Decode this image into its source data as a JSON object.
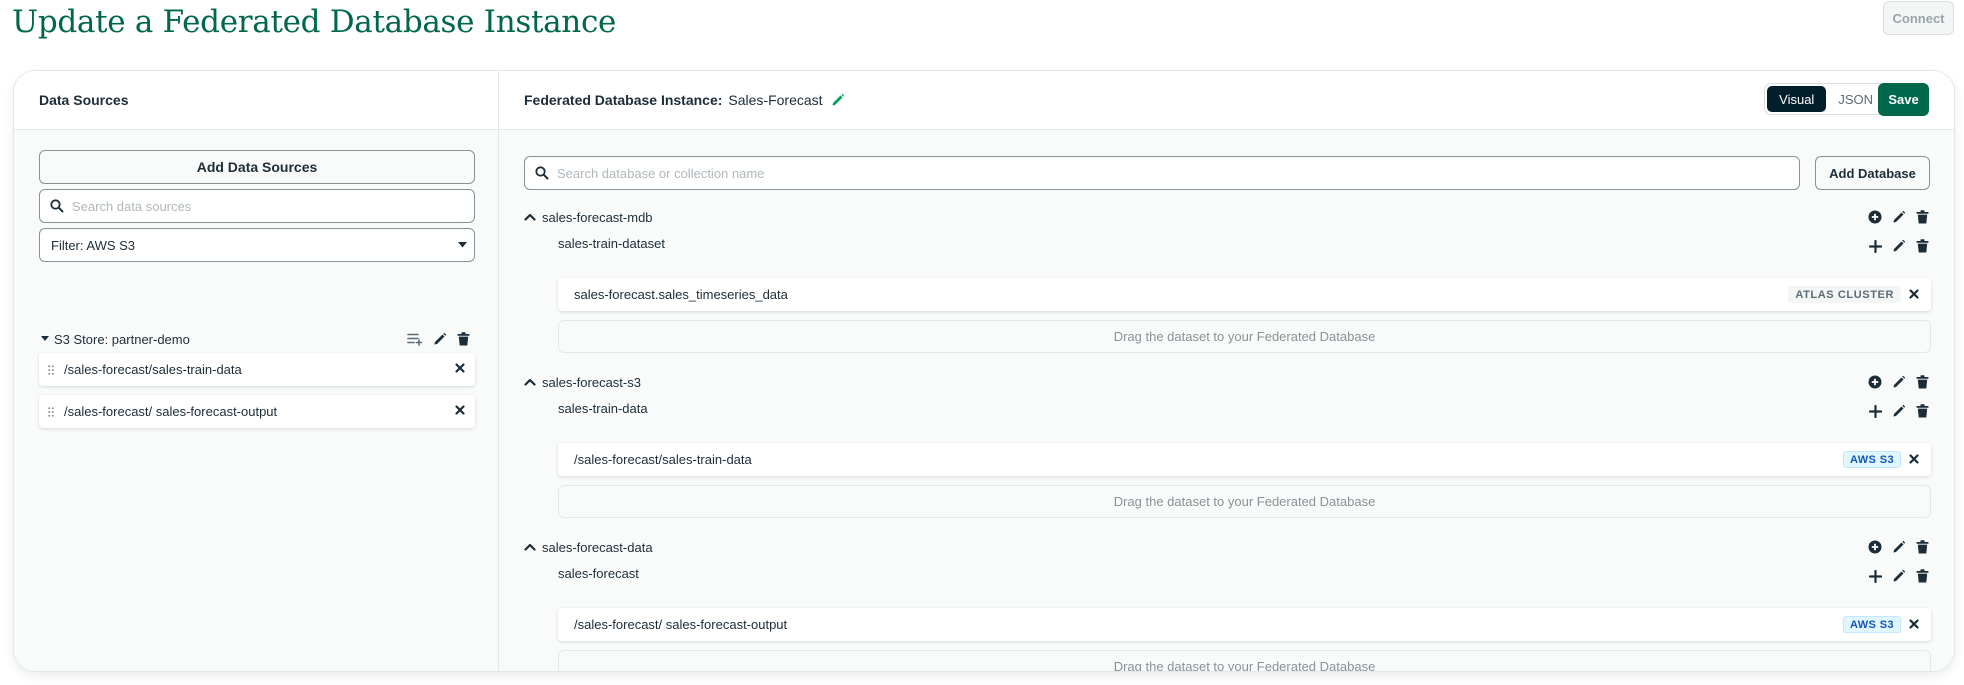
{
  "page": {
    "title": "Update a Federated Database Instance",
    "connect_label": "Connect"
  },
  "left": {
    "title": "Data Sources",
    "add_label": "Add Data Sources",
    "search_placeholder": "Search data sources",
    "filter_label": "Filter: AWS S3",
    "store": {
      "name": "S3 Store: partner-demo",
      "items": [
        "/sales-forecast/sales-train-data",
        "/sales-forecast/ sales-forecast-output"
      ]
    }
  },
  "right": {
    "instance_label": "Federated Database Instance:",
    "instance_name": "Sales-Forecast",
    "toggle": {
      "visual": "Visual",
      "json": "JSON",
      "active": "Visual"
    },
    "save_label": "Save",
    "search_placeholder": "Search database or collection name",
    "add_db_label": "Add Database",
    "drop_text": "Drag the dataset to your Federated Database",
    "databases": [
      {
        "name": "sales-forecast-mdb",
        "collection": "sales-train-dataset",
        "dataset": "sales-forecast.sales_timeseries_data",
        "badge": "ATLAS CLUSTER"
      },
      {
        "name": "sales-forecast-s3",
        "collection": "sales-train-data",
        "dataset": "/sales-forecast/sales-train-data",
        "badge": "AWS S3"
      },
      {
        "name": "sales-forecast-data",
        "collection": "sales-forecast",
        "dataset": "/sales-forecast/ sales-forecast-output",
        "badge": "AWS S3"
      }
    ]
  },
  "colors": {
    "brand_green": "#00684a",
    "dark": "#001e2b",
    "s3_badge": "#1254b7"
  }
}
